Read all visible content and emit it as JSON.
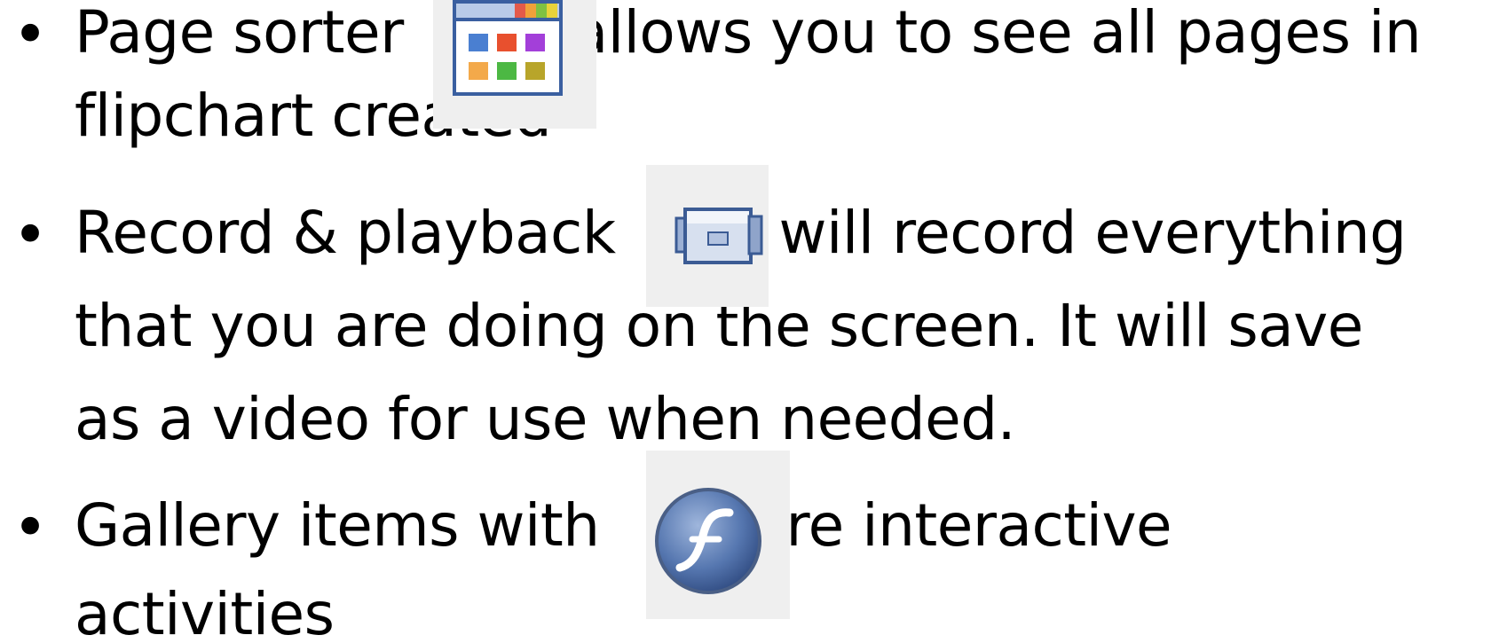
{
  "bullets": [
    {
      "before_icon": "Page sorter",
      "icon": "page-sorter-icon",
      "after_icon": "allows you to see all pages in",
      "continuation": [
        "flipchart created"
      ]
    },
    {
      "before_icon": "Record & playback",
      "icon": "record-playback-icon",
      "after_icon": "will record everything",
      "continuation": [
        "that you are doing on the screen. It will save",
        "as a video for use when needed."
      ]
    },
    {
      "before_icon": "Gallery items with",
      "icon": "flash-activity-icon",
      "after_icon": "are interactive",
      "continuation": [
        "activities"
      ]
    }
  ],
  "bullet_glyph": "•"
}
